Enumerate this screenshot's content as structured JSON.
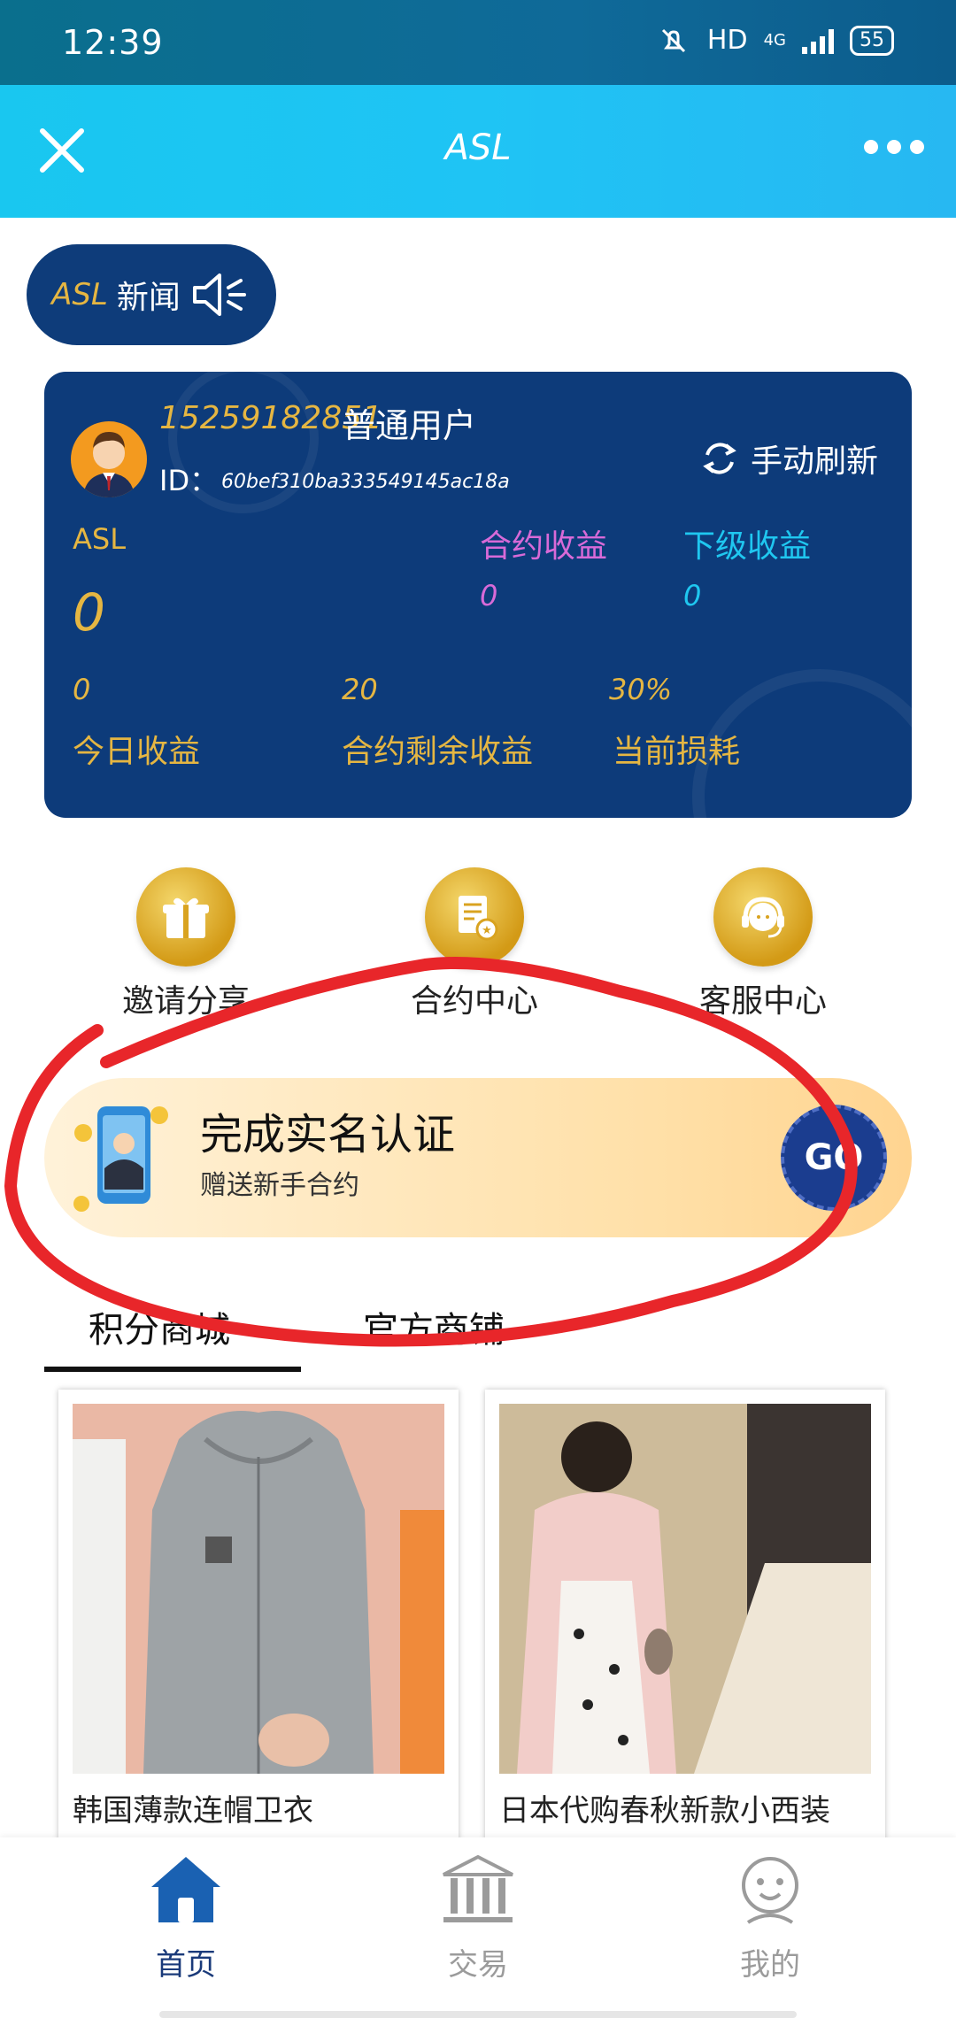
{
  "status_bar": {
    "time": "12:39",
    "network": "HD",
    "net_type": "4G",
    "battery": "55"
  },
  "titlebar": {
    "title": "ASL"
  },
  "news": {
    "brand": "ASL",
    "label": "新闻"
  },
  "account": {
    "phone": "15259182851",
    "user_type": "普通用户",
    "id_label": "ID：",
    "id_value": "60bef310ba333549145ac18a",
    "refresh_label": "手动刷新",
    "asl_label": "ASL",
    "asl_value": "0",
    "contract_income_label": "合约收益",
    "contract_income_value": "0",
    "sub_income_label": "下级收益",
    "sub_income_value": "0",
    "today_value": "0",
    "today_label": "今日收益",
    "remain_value": "20",
    "remain_label": "合约剩余收益",
    "loss_value": "30%",
    "loss_label": "当前损耗",
    "colors": {
      "card": "#0d3b7a",
      "gold": "#e5b642",
      "pink": "#d86ad8",
      "cyan": "#1fc7f0"
    }
  },
  "quick_actions": [
    {
      "label": "邀请分享",
      "icon": "gift-icon"
    },
    {
      "label": "合约中心",
      "icon": "document-icon"
    },
    {
      "label": "客服中心",
      "icon": "headset-icon"
    }
  ],
  "banner": {
    "title": "完成实名认证",
    "subtitle": "赠送新手合约",
    "go": "GO"
  },
  "tabs": [
    {
      "label": "积分商城",
      "active": true
    },
    {
      "label": "官方商铺",
      "active": false
    }
  ],
  "products": [
    {
      "name": "韩国薄款连帽卫衣"
    },
    {
      "name": "日本代购春秋新款小西装"
    }
  ],
  "bottom_nav": [
    {
      "label": "首页",
      "icon": "home-icon",
      "active": true
    },
    {
      "label": "交易",
      "icon": "bank-icon",
      "active": false
    },
    {
      "label": "我的",
      "icon": "profile-face-icon",
      "active": false
    }
  ]
}
